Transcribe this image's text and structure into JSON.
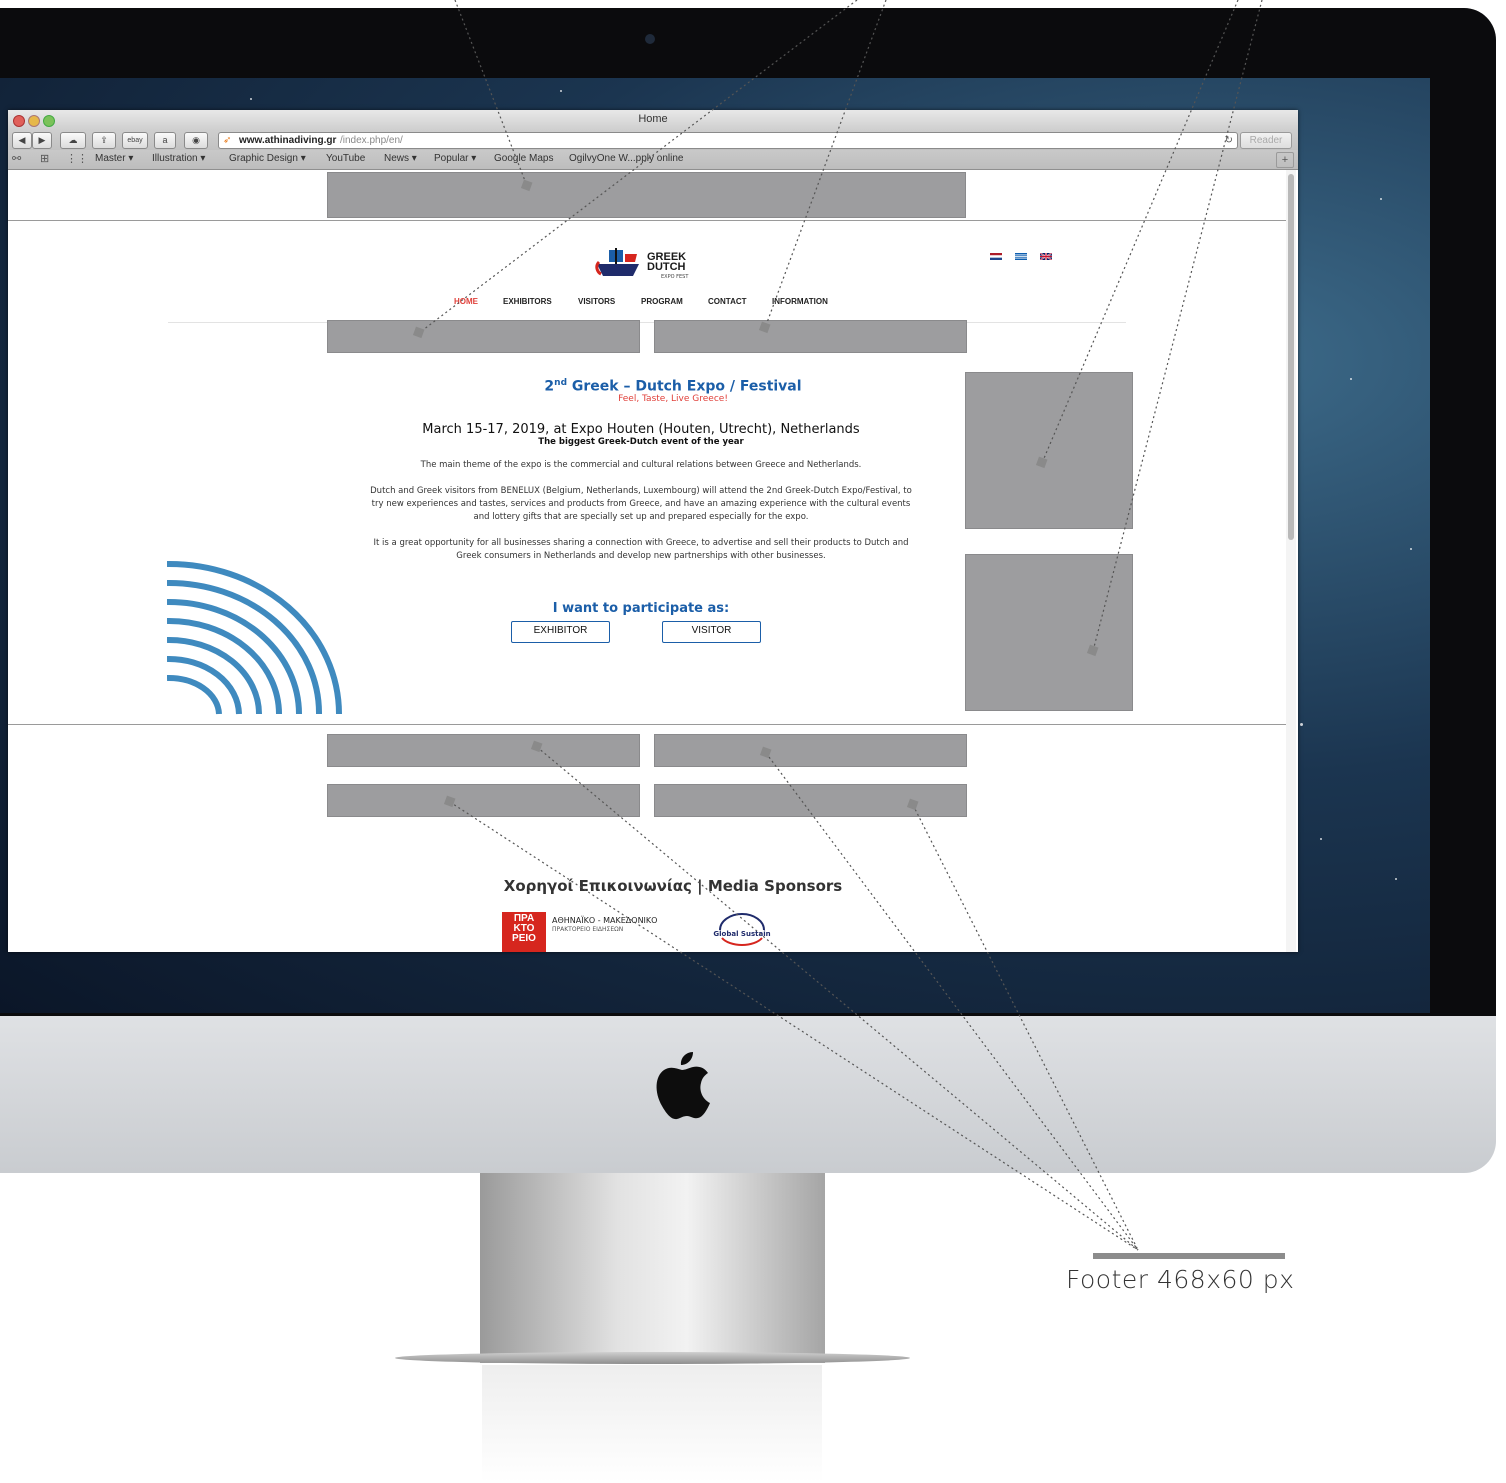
{
  "browser": {
    "window_title": "Home",
    "url_host": "www.athinadiving.gr",
    "url_path": "/index.php/en/",
    "reader_label": "Reader",
    "ebay_label": "ebay",
    "bookmarks": [
      "Master ▾",
      "Illustration ▾",
      "Graphic Design ▾",
      "YouTube",
      "News ▾",
      "Popular ▾",
      "Google Maps",
      "OgilvyOne W...pply online"
    ]
  },
  "site": {
    "logo_line1": "GREEK",
    "logo_line2": "DUTCH",
    "logo_sub": "EXPO FEST",
    "nav": [
      "HOME",
      "EXHIBITORS",
      "VISITORS",
      "PROGRAM",
      "CONTACT",
      "INFORMATION"
    ],
    "title_prefix": "2",
    "title_sup": "nd",
    "title_rest": " Greek – Dutch Expo / Festival",
    "subtitle": "Feel, Taste, Live Greece!",
    "date_line": "March 15-17, 2019, at Expo Houten (Houten, Utrecht), Netherlands",
    "tagline": "The biggest Greek-Dutch event of the year",
    "para1": "The main theme of the expo is the commercial and cultural relations between Greece and Netherlands.",
    "para2": "Dutch and Greek visitors from BENELUX (Belgium, Netherlands, Luxembourg) will attend the 2nd Greek-Dutch Expo/Festival, to try new experiences and tastes, services and products from Greece, and have an amazing experience with the cultural events and lottery gifts that are specially set up and prepared especially for the expo.",
    "para3": "It is a great opportunity for all businesses sharing a connection with Greece, to advertise and sell their products to Dutch and Greek consumers in Netherlands and develop new partnerships with other businesses.",
    "participate_heading": "I want to participate as:",
    "exhibitor_button": "EXHIBITOR",
    "visitor_button": "VISITOR",
    "sponsors_heading": "Χορηγοί Επικοινωνίας | Media Sponsors",
    "sponsor1_logo": "ΠΡΑ ΚΤΟ ΡΕΙΟ",
    "sponsor1_name": "ΑΘΗΝΑΪΚΟ - ΜΑΚΕΔΟΝΙΚΟ",
    "sponsor1_sub": "ΠΡΑΚΤΟΡΕΙΟ ΕΙΔΗΣΕΩΝ",
    "sponsor2_name": "Global Sustain"
  },
  "annotation": {
    "label": "Footer 468x60 px"
  },
  "colors": {
    "brand_blue": "#1b5ea8",
    "accent_red": "#e0403a",
    "ad_gray": "#9d9d9f",
    "arc_blue": "#3f8abf"
  }
}
